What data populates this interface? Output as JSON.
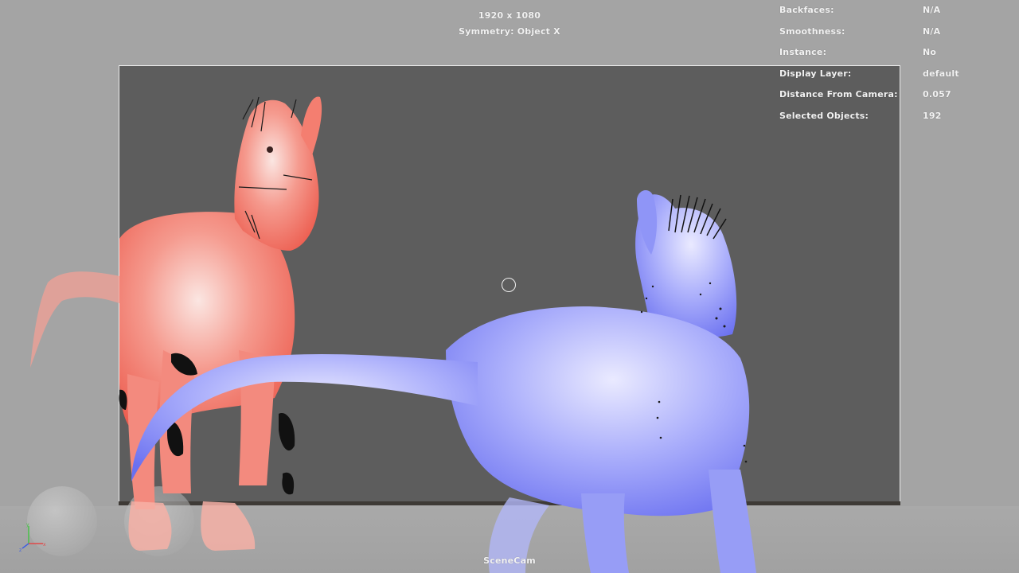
{
  "viewport": {
    "resolution": "1920 x 1080",
    "symmetry": "Symmetry: Object X",
    "camera_name": "SceneCam"
  },
  "hud": {
    "rows": [
      {
        "label": "Backfaces:",
        "value": "N/A"
      },
      {
        "label": "Smoothness:",
        "value": "N/A"
      },
      {
        "label": "Instance:",
        "value": "No"
      },
      {
        "label": "Display Layer:",
        "value": "default"
      },
      {
        "label": "Distance From Camera:",
        "value": "0.057"
      },
      {
        "label": "Selected Objects:",
        "value": "192"
      }
    ]
  },
  "scene": {
    "objects": [
      {
        "name": "red-dinosaur",
        "color": "#f2766a"
      },
      {
        "name": "blue-dinosaur",
        "color": "#9aa0f6"
      }
    ],
    "background_color": "#5d5d5d",
    "gate_border_color": "#ececec"
  },
  "icons": {
    "view_axis": "xyz-axis-icon",
    "manipulator": "circle-manipulator-icon"
  }
}
